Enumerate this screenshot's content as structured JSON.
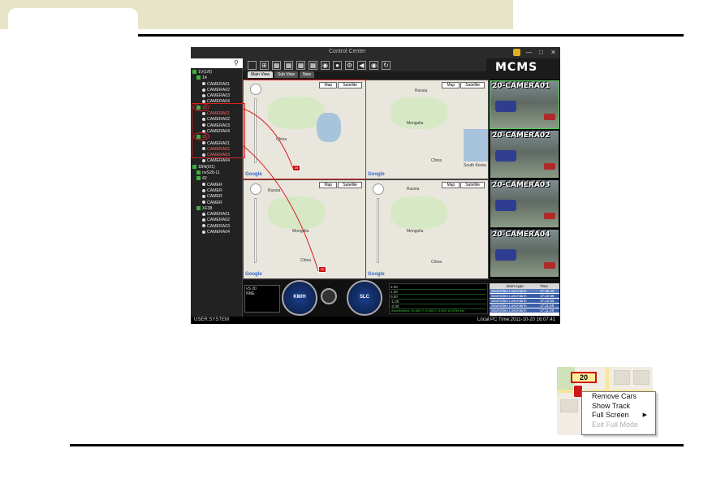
{
  "app": {
    "title": "Control Center",
    "logo": "MCMS",
    "tabs": [
      "Main View",
      "Sub View",
      "New"
    ],
    "search": {
      "value": "",
      "placeholder": ""
    },
    "tree": [
      {
        "label": "1V(1/6)",
        "kind": "root"
      },
      {
        "label": "14",
        "kind": "group"
      },
      {
        "label": "CAMERA01",
        "kind": "cam"
      },
      {
        "label": "CAMERA02",
        "kind": "cam"
      },
      {
        "label": "CAMERA03",
        "kind": "cam"
      },
      {
        "label": "CAMERA04",
        "kind": "cam"
      },
      {
        "label": "20",
        "kind": "group-red"
      },
      {
        "label": "CAMERA01",
        "kind": "cam-red"
      },
      {
        "label": "CAMERA02",
        "kind": "cam"
      },
      {
        "label": "CAMERA03",
        "kind": "cam"
      },
      {
        "label": "CAMERA04",
        "kind": "cam"
      },
      {
        "label": "25",
        "kind": "group-red"
      },
      {
        "label": "CAMERA01",
        "kind": "cam"
      },
      {
        "label": "CAMERA02",
        "kind": "cam-red"
      },
      {
        "label": "CAMERA03",
        "kind": "cam-red"
      },
      {
        "label": "CAMERA04",
        "kind": "cam"
      },
      {
        "label": "1BN(0/1)",
        "kind": "root"
      },
      {
        "label": "nvS28-11",
        "kind": "group"
      },
      {
        "label": "42",
        "kind": "group"
      },
      {
        "label": "CAMER",
        "kind": "cam"
      },
      {
        "label": "CAMER",
        "kind": "cam"
      },
      {
        "label": "CAMER",
        "kind": "cam"
      },
      {
        "label": "CAMER",
        "kind": "cam"
      },
      {
        "label": "XF38",
        "kind": "group"
      },
      {
        "label": "CAMERA01",
        "kind": "cam"
      },
      {
        "label": "CAMERA02",
        "kind": "cam"
      },
      {
        "label": "CAMERA03",
        "kind": "cam"
      },
      {
        "label": "CAMERA04",
        "kind": "cam"
      }
    ],
    "map_buttons": {
      "map": "Map",
      "satellite": "Satellite"
    },
    "map_labels": {
      "russia": "Russia",
      "mongolia": "Mongolia",
      "china": "China",
      "south_korea": "South Korea",
      "google": "Google"
    },
    "map_pin_label": "20",
    "cameras": [
      "20-CAMERA01",
      "20-CAMERA02",
      "20-CAMERA03",
      "20-CAMERA04"
    ],
    "info_box": {
      "id": "vS 20",
      "line2": "NNE"
    },
    "gauges": {
      "speed": "KM/H",
      "alt": "SLC"
    },
    "graph_rows": [
      "2.00",
      "1.00",
      "0.00",
      "-1.00",
      "-2.00"
    ],
    "graph_stat": "Acceleration: 20.000   Y: 0.000   Z: 0.000     10.5784 km",
    "alarm_header": {
      "type": "Alarm type",
      "time": "Time"
    },
    "alarms": [
      {
        "type": "StartVideo LossAlarm",
        "time": "17:35:40"
      },
      {
        "type": "StartVideo LossAlarm",
        "time": "17:22:56"
      },
      {
        "type": "StartVideo LossAlarm",
        "time": "17:22:56"
      },
      {
        "type": "StartVideo LossAlarm",
        "time": "17:11:48"
      },
      {
        "type": "StartVideo LossAlarm",
        "time": "17:11:48"
      }
    ],
    "status_user": "USER:SYSTEM",
    "status_time": "Local PC Time:2011-10-20 16:07:41"
  },
  "context_example": {
    "badge": "20",
    "menu": [
      {
        "label": "Remove Cars",
        "enabled": true,
        "submenu": false
      },
      {
        "label": "Show Track",
        "enabled": true,
        "submenu": false
      },
      {
        "label": "Full Screen",
        "enabled": true,
        "submenu": true
      },
      {
        "label": "Exit Full Mode",
        "enabled": false,
        "submenu": false
      }
    ]
  },
  "colors": {
    "header_band": "#e8e4c8",
    "annotation_red": "#d82020",
    "camera_selected": "#52d052",
    "alarm_row": "#3b5ea8"
  }
}
